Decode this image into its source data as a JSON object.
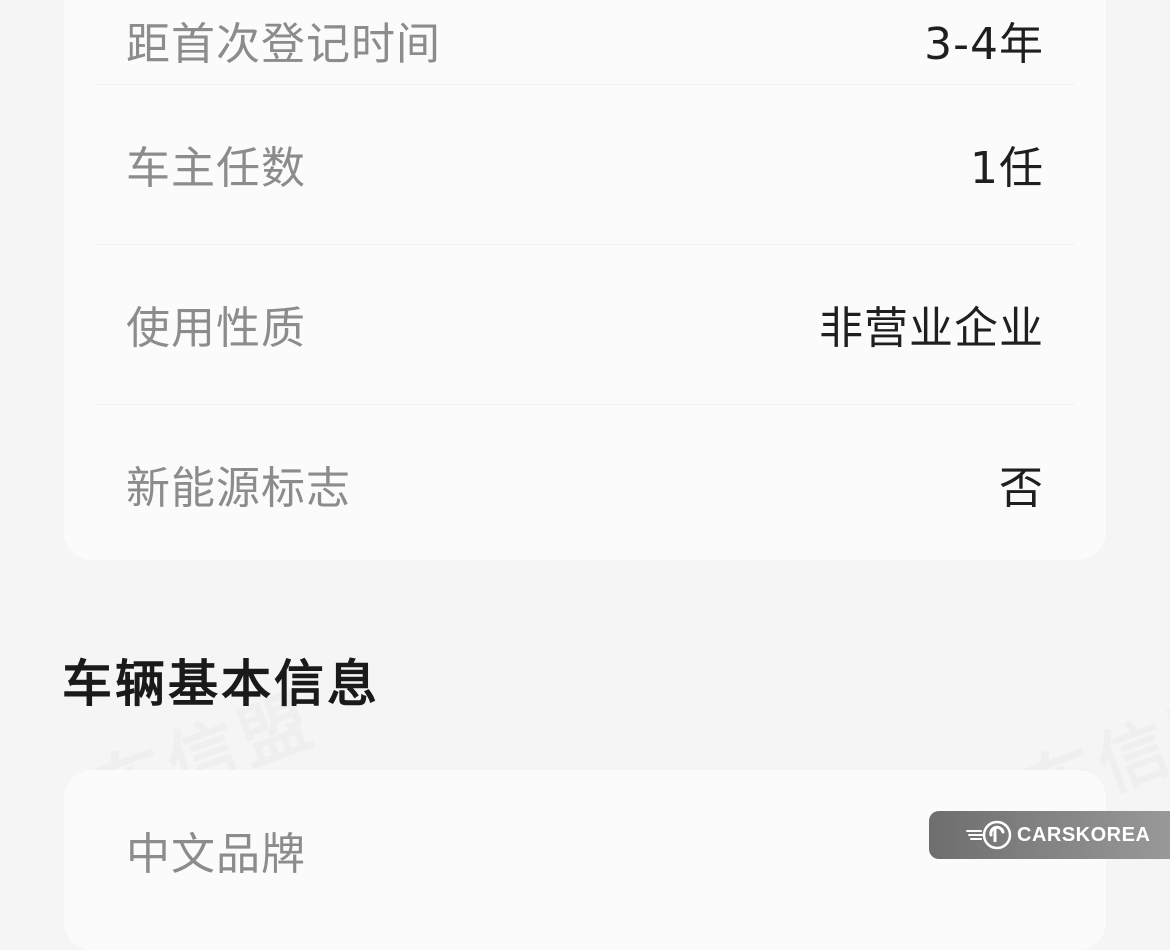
{
  "top_card": {
    "rows": [
      {
        "label": "距首次登记时间",
        "value": "3-4年"
      },
      {
        "label": "车主任数",
        "value": "1任"
      },
      {
        "label": "使用性质",
        "value": "非营业企业"
      },
      {
        "label": "新能源标志",
        "value": "否"
      }
    ]
  },
  "section": {
    "title": "车辆基本信息"
  },
  "bottom_card": {
    "rows": [
      {
        "label": "中文品牌",
        "value": ""
      }
    ]
  },
  "watermark": {
    "text": "车信盟"
  },
  "brand_badge": {
    "text": "CARSKOREA"
  },
  "colors": {
    "background": "#f5f5f5",
    "card": "#fbfbfb",
    "label": "#8c8c8c",
    "value": "#1f1f1f"
  }
}
